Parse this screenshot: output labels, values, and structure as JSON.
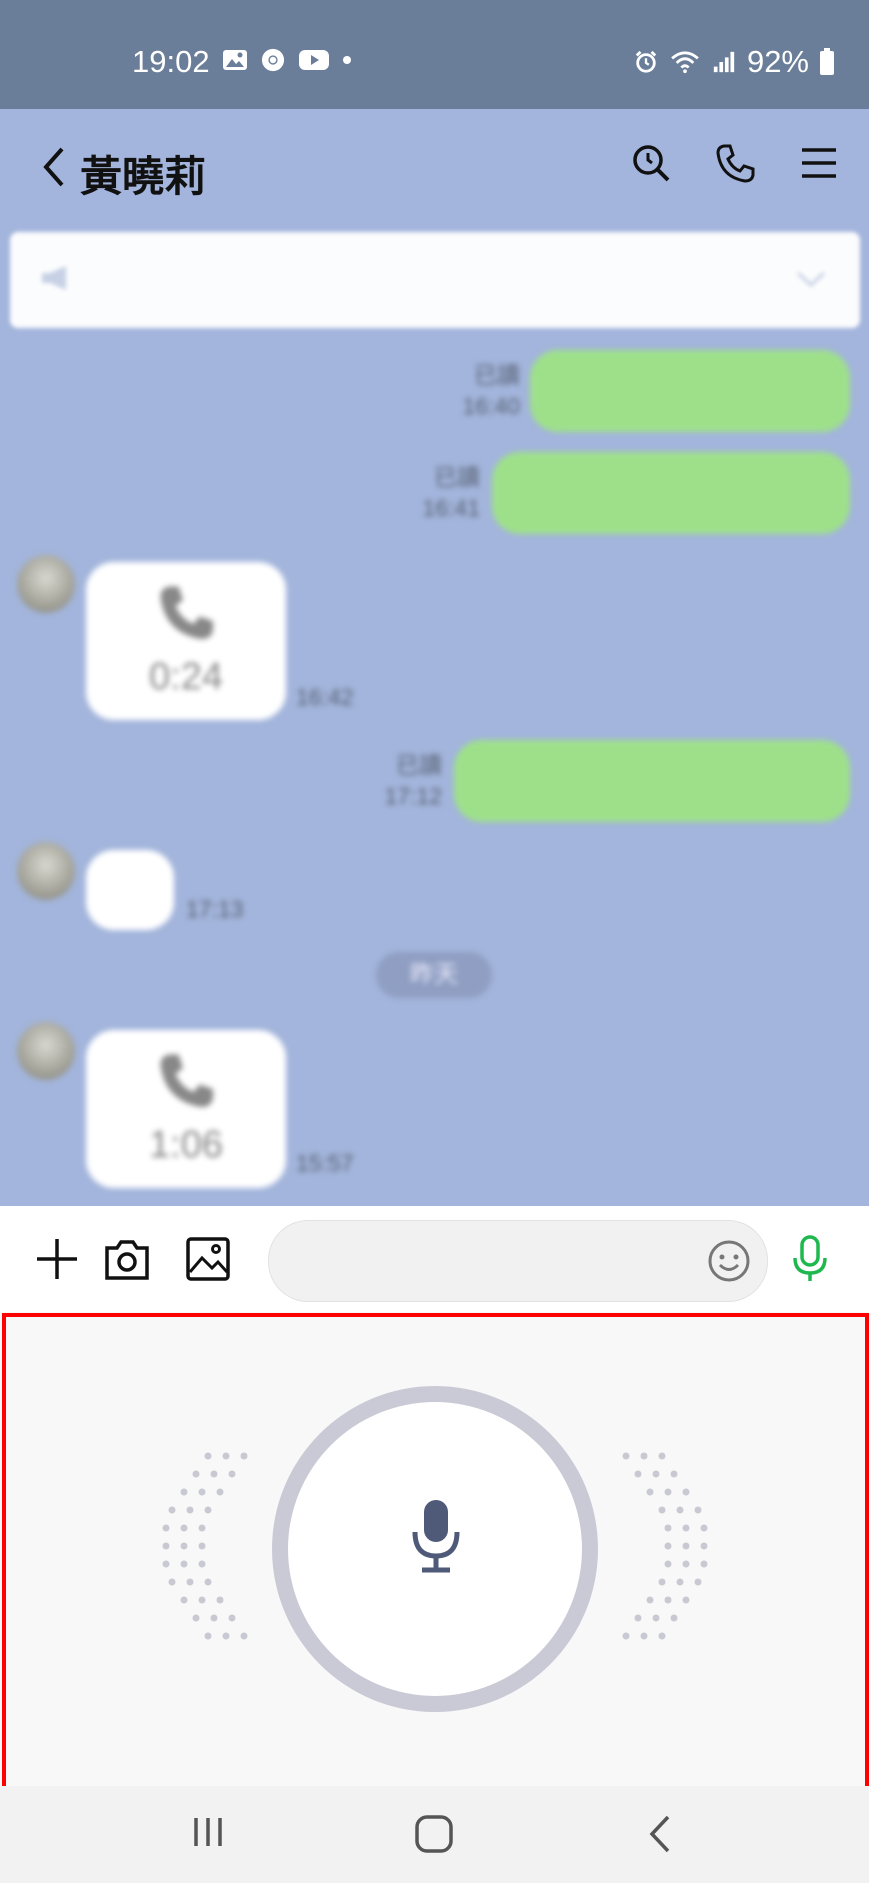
{
  "status_bar": {
    "time": "19:02",
    "battery": "92%",
    "left_icons": [
      "gallery-icon",
      "chrome-icon",
      "youtube-icon",
      "dot"
    ],
    "right_icons": [
      "alarm-icon",
      "wifi-icon",
      "signal-icon",
      "battery-icon"
    ]
  },
  "header": {
    "title": "黃曉莉",
    "icons": [
      "search-icon",
      "phone-icon",
      "menu-icon"
    ]
  },
  "chat": {
    "messages": [
      {
        "side": "right",
        "status": "已讀",
        "time": "16:40"
      },
      {
        "side": "right",
        "status": "已讀",
        "time": "16:41"
      },
      {
        "side": "left",
        "type": "call",
        "duration": "0:24",
        "time": "16:42"
      },
      {
        "side": "right",
        "status": "已讀",
        "time": "17:12"
      },
      {
        "side": "left",
        "type": "text",
        "time": "17:13"
      },
      {
        "side": "left",
        "type": "call",
        "duration": "1:06",
        "time": "15:57"
      }
    ],
    "date_separator": "昨天"
  },
  "input_bar": {
    "placeholder": "",
    "icons": [
      "plus-icon",
      "camera-icon",
      "image-icon",
      "emoji-icon",
      "mic-icon"
    ]
  },
  "voice_panel": {
    "record_button_icon": "mic-icon"
  },
  "colors": {
    "status_bar": "#6b7e99",
    "chat_bg": "#a3b5dc",
    "green_bubble": "#9ee08a",
    "mic_accent": "#1fb84f",
    "highlight": "#ff0000"
  },
  "nav_bar": {
    "buttons": [
      "recents-icon",
      "home-icon",
      "back-icon"
    ]
  }
}
